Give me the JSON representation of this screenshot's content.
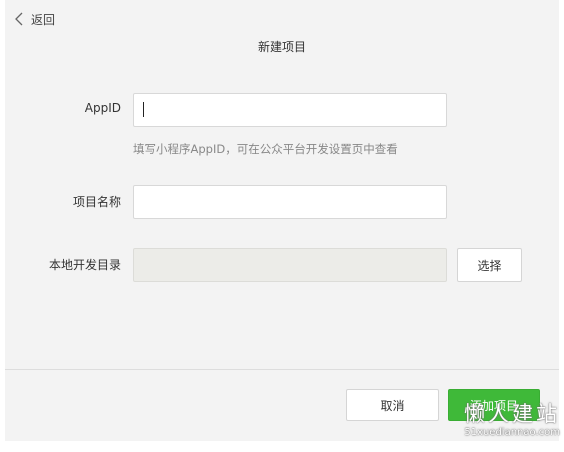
{
  "header": {
    "back_label": "返回",
    "title": "新建项目"
  },
  "form": {
    "appid_label": "AppID",
    "appid_value": "",
    "appid_hint": "填写小程序AppID，可在公众平台开发设置页中查看",
    "name_label": "项目名称",
    "name_value": "",
    "dir_label": "本地开发目录",
    "dir_value": "",
    "choose_label": "选择"
  },
  "footer": {
    "cancel_label": "取消",
    "add_label": "添加项目"
  },
  "watermark": {
    "main": "懒人建站",
    "sub": "51xuediannao.com"
  },
  "colors": {
    "primary": "#3fb939",
    "background": "#f3f3f3"
  },
  "icons": {
    "back": "chevron-left-icon"
  }
}
